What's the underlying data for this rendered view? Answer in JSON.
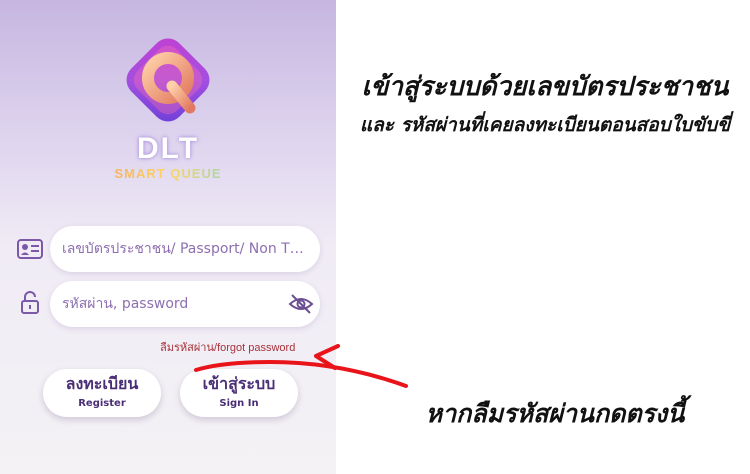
{
  "app": {
    "brand_name": "DLT",
    "brand_tagline": "SMART QUEUE",
    "logo_letter": "Q"
  },
  "form": {
    "id_placeholder": "เลขบัตรประชาชน/ Passport/ Non Thai...",
    "password_placeholder": "รหัสผ่าน, password",
    "forgot_link": "ลืมรหัสผ่าน/forgot password"
  },
  "buttons": {
    "register_th": "ลงทะเบียน",
    "register_en": "Register",
    "signin_th": "เข้าสู่ระบบ",
    "signin_en": "Sign In"
  },
  "annotations": {
    "headline_line1": "เข้าสู่ระบบด้วยเลขบัตรประชาชน",
    "headline_line2": "และ รหัสผ่านที่เคยลงทะเบียนตอนสอบใบขับขี่",
    "forgot_note": "หากลืมรหัสผ่านกดตรงนี้"
  },
  "colors": {
    "accent": "#4a2f77",
    "link": "#a8323a",
    "arrow": "#e8141a"
  },
  "icons": [
    "id-card-icon",
    "unlock-icon",
    "eye-off-icon"
  ]
}
